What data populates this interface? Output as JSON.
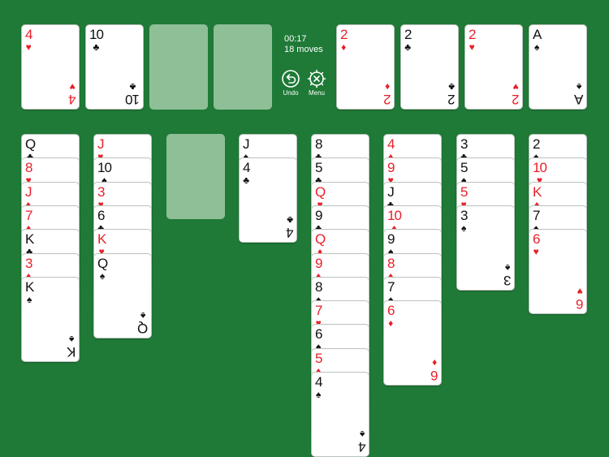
{
  "colors": {
    "felt": "#1e7a36",
    "placeholder": "#8fbf96",
    "red_suit": "#e8202a",
    "black_suit": "#111111",
    "card_face": "#ffffff"
  },
  "status": {
    "time": "00:17",
    "moves": "18 moves"
  },
  "controls": {
    "undo_label": "Undo",
    "menu_label": "Menu"
  },
  "free_cells": [
    {
      "rank": "4",
      "suit": "♥",
      "color": "red"
    },
    {
      "rank": "10",
      "suit": "♣",
      "color": "black"
    },
    null,
    null
  ],
  "foundations": [
    {
      "rank": "2",
      "suit": "♦",
      "color": "red"
    },
    {
      "rank": "2",
      "suit": "♣",
      "color": "black"
    },
    {
      "rank": "2",
      "suit": "♥",
      "color": "red"
    },
    {
      "rank": "A",
      "suit": "♠",
      "color": "black"
    }
  ],
  "tableau": [
    [
      {
        "rank": "Q",
        "suit": "♣",
        "color": "black"
      },
      {
        "rank": "8",
        "suit": "♥",
        "color": "red"
      },
      {
        "rank": "J",
        "suit": "♦",
        "color": "red"
      },
      {
        "rank": "7",
        "suit": "♦",
        "color": "red"
      },
      {
        "rank": "K",
        "suit": "♣",
        "color": "black"
      },
      {
        "rank": "3",
        "suit": "♦",
        "color": "red"
      },
      {
        "rank": "K",
        "suit": "♠",
        "color": "black"
      }
    ],
    [
      {
        "rank": "J",
        "suit": "♥",
        "color": "red"
      },
      {
        "rank": "10",
        "suit": "♠",
        "color": "black"
      },
      {
        "rank": "3",
        "suit": "♥",
        "color": "red"
      },
      {
        "rank": "6",
        "suit": "♣",
        "color": "black"
      },
      {
        "rank": "K",
        "suit": "♥",
        "color": "red"
      },
      {
        "rank": "Q",
        "suit": "♠",
        "color": "black"
      }
    ],
    [],
    [
      {
        "rank": "J",
        "suit": "♠",
        "color": "black"
      },
      {
        "rank": "4",
        "suit": "♣",
        "color": "black"
      }
    ],
    [
      {
        "rank": "8",
        "suit": "♣",
        "color": "black"
      },
      {
        "rank": "5",
        "suit": "♣",
        "color": "black"
      },
      {
        "rank": "Q",
        "suit": "♥",
        "color": "red"
      },
      {
        "rank": "9",
        "suit": "♣",
        "color": "black"
      },
      {
        "rank": "Q",
        "suit": "♦",
        "color": "red"
      },
      {
        "rank": "9",
        "suit": "♦",
        "color": "red"
      },
      {
        "rank": "8",
        "suit": "♠",
        "color": "black"
      },
      {
        "rank": "7",
        "suit": "♥",
        "color": "red"
      },
      {
        "rank": "6",
        "suit": "♠",
        "color": "black"
      },
      {
        "rank": "5",
        "suit": "♦",
        "color": "red"
      },
      {
        "rank": "4",
        "suit": "♠",
        "color": "black"
      }
    ],
    [
      {
        "rank": "4",
        "suit": "♦",
        "color": "red"
      },
      {
        "rank": "9",
        "suit": "♥",
        "color": "red"
      },
      {
        "rank": "J",
        "suit": "♣",
        "color": "black"
      },
      {
        "rank": "10",
        "suit": "♦",
        "color": "red"
      },
      {
        "rank": "9",
        "suit": "♠",
        "color": "black"
      },
      {
        "rank": "8",
        "suit": "♦",
        "color": "red"
      },
      {
        "rank": "7",
        "suit": "♠",
        "color": "black"
      },
      {
        "rank": "6",
        "suit": "♦",
        "color": "red"
      }
    ],
    [
      {
        "rank": "3",
        "suit": "♣",
        "color": "black"
      },
      {
        "rank": "5",
        "suit": "♠",
        "color": "black"
      },
      {
        "rank": "5",
        "suit": "♥",
        "color": "red"
      },
      {
        "rank": "3",
        "suit": "♠",
        "color": "black"
      }
    ],
    [
      {
        "rank": "2",
        "suit": "♠",
        "color": "black"
      },
      {
        "rank": "10",
        "suit": "♥",
        "color": "red"
      },
      {
        "rank": "K",
        "suit": "♦",
        "color": "red"
      },
      {
        "rank": "7",
        "suit": "♠",
        "color": "black"
      },
      {
        "rank": "6",
        "suit": "♥",
        "color": "red"
      }
    ]
  ]
}
